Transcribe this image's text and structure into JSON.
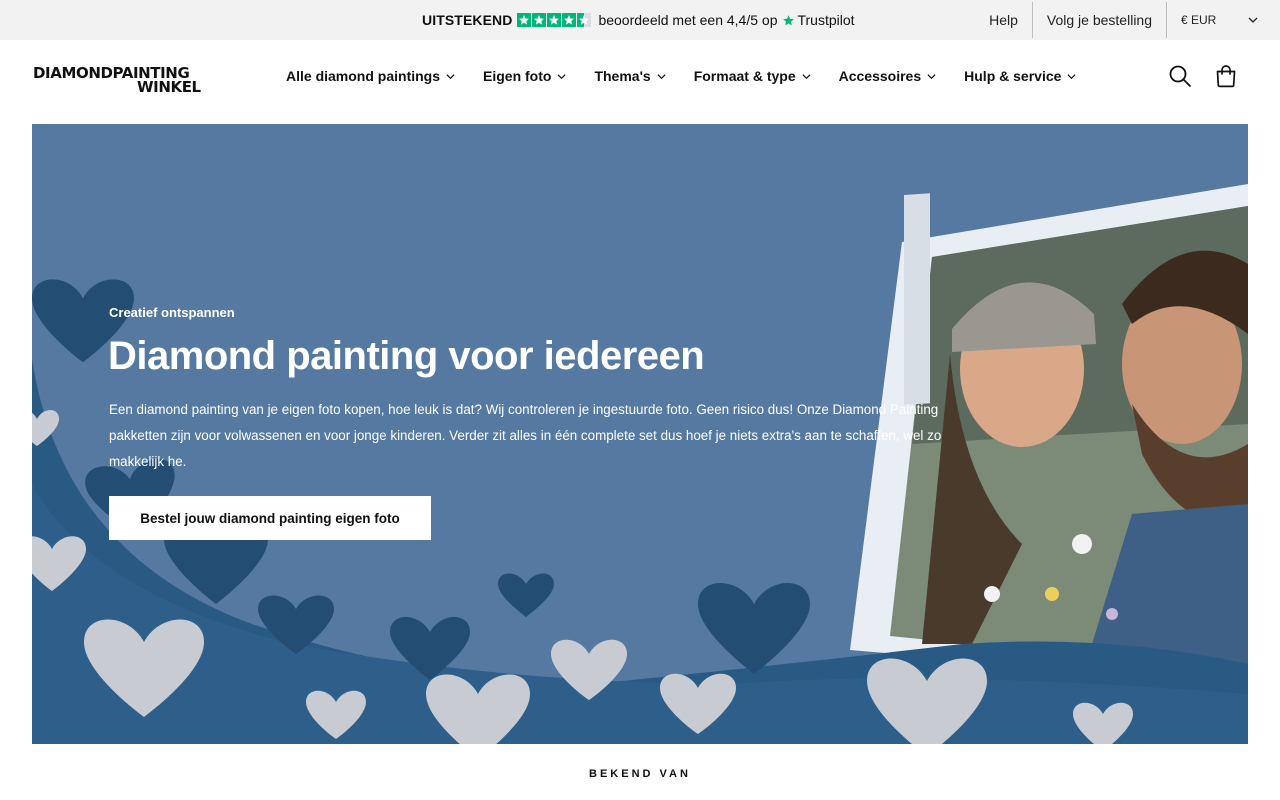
{
  "trustbar": {
    "rating_word": "UITSTEKEND",
    "rating_text": "beoordeeld met een 4,4/5 op",
    "brand": "Trustpilot",
    "stars": 4.5,
    "star_color": "#00b67a"
  },
  "toplinks": {
    "help": "Help",
    "track_order": "Volg je bestelling",
    "currency": "€ EUR"
  },
  "logo": {
    "line1": "DIAMONDPAINTING",
    "line2": "WINKEL"
  },
  "nav": [
    {
      "label": "Alle diamond paintings"
    },
    {
      "label": "Eigen foto"
    },
    {
      "label": "Thema's"
    },
    {
      "label": "Formaat & type"
    },
    {
      "label": "Accessoires"
    },
    {
      "label": "Hulp & service"
    }
  ],
  "header_icons": [
    "search-icon",
    "shopping-bag-icon"
  ],
  "hero": {
    "eyebrow": "Creatief ontspannen",
    "title": "Diamond painting voor iedereen",
    "description": "Een diamond painting van je eigen foto kopen, hoe leuk is dat? Wij controleren je ingestuurde foto. Geen risico dus! Onze Diamond Painting pakketten zijn voor volwassenen en voor jonge kinderen. Verder zit alles in één complete set dus hoef je niets extra's aan te schaffen, wel zo makkelijk he.",
    "cta": "Bestel jouw diamond painting eigen foto",
    "background_color": "#5579a0",
    "wave_color": "#295a84"
  },
  "known_from": "BEKEND VAN"
}
